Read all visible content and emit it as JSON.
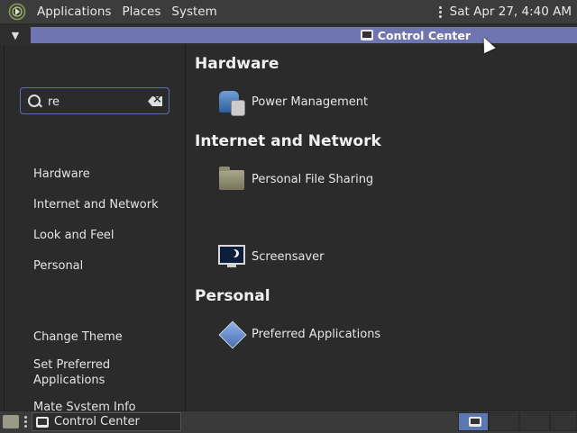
{
  "top_panel": {
    "menus": [
      "Applications",
      "Places",
      "System"
    ],
    "clock": "Sat Apr 27,  4:40 AM"
  },
  "window": {
    "title": "Control Center"
  },
  "search": {
    "value": "re",
    "placeholder": ""
  },
  "sidebar": {
    "categories": [
      "Hardware",
      "Internet and Network",
      "Look and Feel",
      "Personal"
    ],
    "tasks": [
      "Change Theme",
      "Set Preferred Applications",
      "Mate System Info"
    ]
  },
  "content": {
    "sections": [
      {
        "title": "Hardware",
        "items": [
          {
            "label": "Power Management",
            "icon": "power-management-icon"
          }
        ]
      },
      {
        "title": "Internet and Network",
        "items": [
          {
            "label": "Personal File Sharing",
            "icon": "folder-icon"
          }
        ]
      },
      {
        "title": "",
        "items": [
          {
            "label": "Screensaver",
            "icon": "screensaver-icon"
          }
        ]
      },
      {
        "title": "Personal",
        "items": [
          {
            "label": "Preferred Applications",
            "icon": "preferred-applications-icon"
          }
        ]
      }
    ]
  },
  "taskbar": {
    "task_label": "Control Center"
  },
  "colors": {
    "title_bar_accent": "#6f75b0",
    "search_border": "#5d6fb0",
    "workspace_active": "#5b76b0"
  }
}
